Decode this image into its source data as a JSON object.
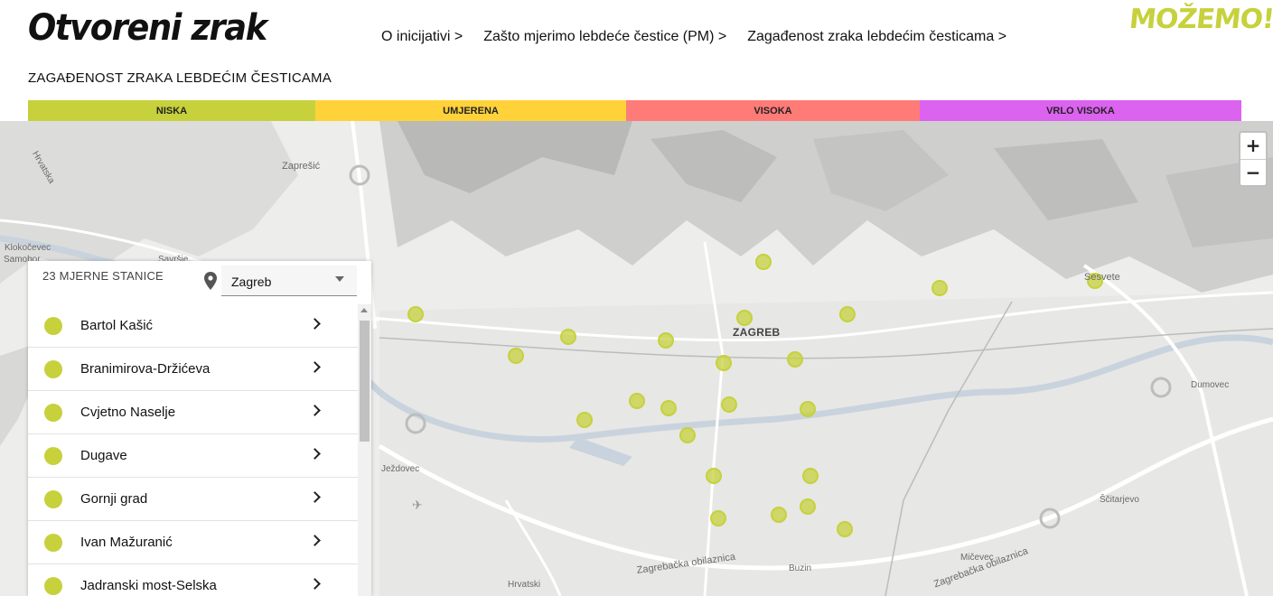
{
  "header": {
    "site_title": "Otvoreni zrak",
    "brand": "MOŽEMO!",
    "nav": [
      {
        "label": "O inicijativi >"
      },
      {
        "label": "Zašto mjerimo lebdeće čestice (PM) >"
      },
      {
        "label": "Zagađenost zraka lebdećim česticama >"
      }
    ],
    "subtitle": "ZAGAĐENOST ZRAKA LEBDEĆIM ČESTICAMA"
  },
  "legend": [
    {
      "label": "NISKA",
      "color": "#c6d13c"
    },
    {
      "label": "UMJERENA",
      "color": "#ffd23a"
    },
    {
      "label": "VISOKA",
      "color": "#ff7b78"
    },
    {
      "label": "VRLO VISOKA",
      "color": "#dc62f0"
    }
  ],
  "map": {
    "zoom_in": "+",
    "zoom_out": "−",
    "labels": {
      "zapresic": "Zaprešić",
      "hrvatska": "Hrvatska",
      "klokocevec": "Klokočevec",
      "samobor": "Samobor",
      "savrsje": "Savršje",
      "zagreb": "ZAGREB",
      "sesvete": "Sesvete",
      "dumovec": "Dumovec",
      "jezdovec": "Ježdovec",
      "scitarjevo": "Ščitarjevo",
      "micevec": "Mičevec",
      "buzin": "Buzin",
      "hrvatski": "Hrvatski",
      "obilaznica1": "Zagrebačka obilaznica",
      "obilaznica2": "Zagrebačka obilaznica"
    },
    "marker_color": "#c6d13c"
  },
  "panel": {
    "station_count": "23 MJERNE STANICE",
    "city": "Zagreb",
    "stations": [
      {
        "name": "Bartol Kašić"
      },
      {
        "name": "Branimirova-Držićeva"
      },
      {
        "name": "Cvjetno Naselje"
      },
      {
        "name": "Dugave"
      },
      {
        "name": "Gornji grad"
      },
      {
        "name": "Ivan Mažuranić"
      },
      {
        "name": "Jadranski most-Selska"
      }
    ]
  }
}
